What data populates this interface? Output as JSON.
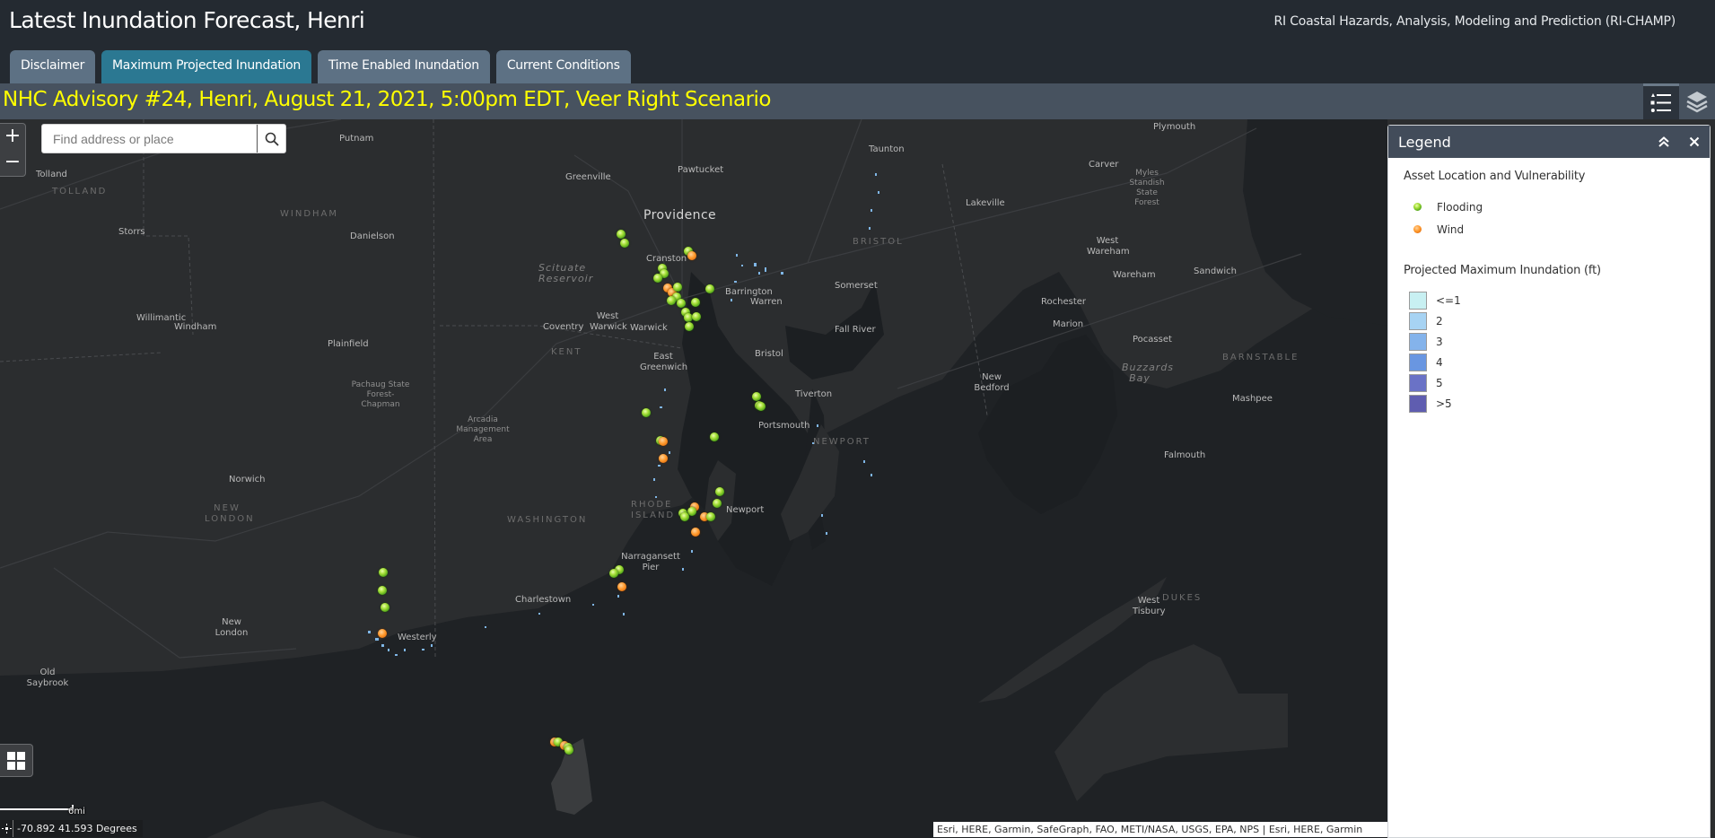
{
  "header": {
    "title": "Latest Inundation Forecast, Henri",
    "subtitle": "RI Coastal Hazards, Analysis, Modeling and Prediction (RI-CHAMP)"
  },
  "tabs": [
    {
      "label": "Disclaimer",
      "active": false
    },
    {
      "label": "Maximum Projected Inundation",
      "active": true
    },
    {
      "label": "Time Enabled Inundation",
      "active": false
    },
    {
      "label": "Current Conditions",
      "active": false
    }
  ],
  "advisory": {
    "text": "NHC Advisory #24, Henri, August 21, 2021, 5:00pm EDT, Veer Right Scenario",
    "color": "#ffff00"
  },
  "toolbar": {
    "legend_icon": "legend-list-icon",
    "layers_icon": "layers-icon"
  },
  "map": {
    "zoom_in": "+",
    "zoom_out": "−",
    "search_placeholder": "Find address or place",
    "scale_label": "6mi",
    "coordinates": "-70.892 41.593 Degrees",
    "attribution": "Esri, HERE, Garmin, SafeGraph, FAO, METI/NASA, USGS, EPA, NPS | Esri, HERE, Garmin",
    "labels": {
      "providence": "Providence",
      "pawtucket": "Pawtucket",
      "greenville": "Greenville",
      "cranston": "Cranston",
      "putnam": "Putnam",
      "tolland": "Tolland",
      "tolland_county": "TOLLAND",
      "windham_county": "WINDHAM",
      "storrs": "Storrs",
      "danielson": "Danielson",
      "willimantic": "Willimantic",
      "windham": "Windham",
      "plainfield": "Plainfield",
      "pachaug": "Pachaug State Forest-Chapman",
      "arcadia": "Arcadia Management Area",
      "scituate": "Scituate Reservoir",
      "coventry": "Coventry",
      "west_warwick": "West Warwick",
      "warwick": "Warwick",
      "kent_county": "KENT",
      "east_greenwich": "East Greenwich",
      "barrington": "Barrington",
      "warren": "Warren",
      "bristol": "Bristol",
      "bristol_county": "BRISTOL",
      "somerset": "Somerset",
      "fall_river": "Fall River",
      "tiverton": "Tiverton",
      "portsmouth": "Portsmouth",
      "newport_county": "NEWPORT",
      "newport": "Newport",
      "rhode_island": "RHODE ISLAND",
      "washington_county": "WASHINGTON",
      "narragansett_pier": "Narragansett Pier",
      "charlestown": "Charlestown",
      "westerly": "Westerly",
      "norwich": "Norwich",
      "new_london_county": "NEW LONDON",
      "new_london": "New London",
      "old_saybrook": "Old Saybrook",
      "taunton": "Taunton",
      "lakeville": "Lakeville",
      "plymouth": "Plymouth",
      "carver": "Carver",
      "myles_standish": "Myles Standish State Forest",
      "west_wareham": "West Wareham",
      "wareham": "Wareham",
      "sandwich": "Sandwich",
      "rochester": "Rochester",
      "marion": "Marion",
      "new_bedford": "New Bedford",
      "buzzards_bay": "Buzzards Bay",
      "pocasset": "Pocasset",
      "barnstable_county": "BARNSTABLE",
      "mashpee": "Mashpee",
      "falmouth": "Falmouth",
      "west_tisbury": "West Tisbury",
      "dukes_county": "DUKES"
    },
    "markers": [
      {
        "type": "flood",
        "lon": -71.485,
        "lat": 41.915
      },
      {
        "type": "flood",
        "lon": -71.479,
        "lat": 41.903
      },
      {
        "type": "flood",
        "lon": -71.388,
        "lat": 41.891
      },
      {
        "type": "wind",
        "lon": -71.382,
        "lat": 41.884
      },
      {
        "type": "flood",
        "lon": -71.425,
        "lat": 41.867
      },
      {
        "type": "flood",
        "lon": -71.423,
        "lat": 41.859
      },
      {
        "type": "flood",
        "lon": -71.432,
        "lat": 41.853
      },
      {
        "type": "wind",
        "lon": -71.417,
        "lat": 41.838
      },
      {
        "type": "wind",
        "lon": -71.411,
        "lat": 41.832
      },
      {
        "type": "flood",
        "lon": -71.403,
        "lat": 41.84
      },
      {
        "type": "flood",
        "lon": -71.405,
        "lat": 41.826
      },
      {
        "type": "flood",
        "lon": -71.412,
        "lat": 41.82
      },
      {
        "type": "flood",
        "lon": -71.398,
        "lat": 41.816
      },
      {
        "type": "flood",
        "lon": -71.357,
        "lat": 41.837
      },
      {
        "type": "flood",
        "lon": -71.378,
        "lat": 41.818
      },
      {
        "type": "flood",
        "lon": -71.392,
        "lat": 41.803
      },
      {
        "type": "flood",
        "lon": -71.388,
        "lat": 41.796
      },
      {
        "type": "flood",
        "lon": -71.376,
        "lat": 41.797
      },
      {
        "type": "flood",
        "lon": -71.387,
        "lat": 41.783
      },
      {
        "type": "flood",
        "lon": -71.449,
        "lat": 41.66
      },
      {
        "type": "flood",
        "lon": -71.428,
        "lat": 41.62
      },
      {
        "type": "wind",
        "lon": -71.424,
        "lat": 41.618
      },
      {
        "type": "wind",
        "lon": -71.424,
        "lat": 41.594
      },
      {
        "type": "flood",
        "lon": -71.29,
        "lat": 41.683
      },
      {
        "type": "flood",
        "lon": -71.285,
        "lat": 41.67
      },
      {
        "type": "flood",
        "lon": -71.283,
        "lat": 41.668
      },
      {
        "type": "flood",
        "lon": -71.35,
        "lat": 41.625
      },
      {
        "type": "flood",
        "lon": -71.343,
        "lat": 41.546
      },
      {
        "type": "flood",
        "lon": -71.346,
        "lat": 41.53
      },
      {
        "type": "wind",
        "lon": -71.379,
        "lat": 41.525
      },
      {
        "type": "flood",
        "lon": -71.383,
        "lat": 41.518
      },
      {
        "type": "flood",
        "lon": -71.396,
        "lat": 41.516
      },
      {
        "type": "flood",
        "lon": -71.393,
        "lat": 41.51
      },
      {
        "type": "wind",
        "lon": -71.364,
        "lat": 41.51
      },
      {
        "type": "flood",
        "lon": -71.356,
        "lat": 41.51
      },
      {
        "type": "wind",
        "lon": -71.378,
        "lat": 41.489
      },
      {
        "type": "flood",
        "lon": -71.488,
        "lat": 41.434
      },
      {
        "type": "flood",
        "lon": -71.495,
        "lat": 41.429
      },
      {
        "type": "wind",
        "lon": -71.483,
        "lat": 41.41
      },
      {
        "type": "flood",
        "lon": -71.827,
        "lat": 41.43
      },
      {
        "type": "flood",
        "lon": -71.829,
        "lat": 41.405
      },
      {
        "type": "flood",
        "lon": -71.825,
        "lat": 41.381
      },
      {
        "type": "wind",
        "lon": -71.829,
        "lat": 41.343
      },
      {
        "type": "wind",
        "lon": -71.58,
        "lat": 41.188
      },
      {
        "type": "flood",
        "lon": -71.575,
        "lat": 41.188
      },
      {
        "type": "wind",
        "lon": -71.566,
        "lat": 41.182
      },
      {
        "type": "flood",
        "lon": -71.561,
        "lat": 41.18
      },
      {
        "type": "flood",
        "lon": -71.56,
        "lat": 41.176
      }
    ]
  },
  "legend": {
    "title": "Legend",
    "collapse_icon": "double-chevron-up-icon",
    "close_icon": "close-icon",
    "section_assets": "Asset Location and Vulnerability",
    "assets": [
      {
        "label": "Flooding",
        "type": "flood",
        "color": "#6cc11e"
      },
      {
        "label": "Wind",
        "type": "wind",
        "color": "#ff9430"
      }
    ],
    "section_inundation": "Projected Maximum Inundation (ft)",
    "inundation": [
      {
        "label": "<=1",
        "color": "#c8f0f2"
      },
      {
        "label": "2",
        "color": "#a7d3f3"
      },
      {
        "label": "3",
        "color": "#84b3eb"
      },
      {
        "label": "4",
        "color": "#6996e1"
      },
      {
        "label": "5",
        "color": "#6a72c6"
      },
      {
        "label": ">5",
        "color": "#5f5db0"
      }
    ]
  }
}
